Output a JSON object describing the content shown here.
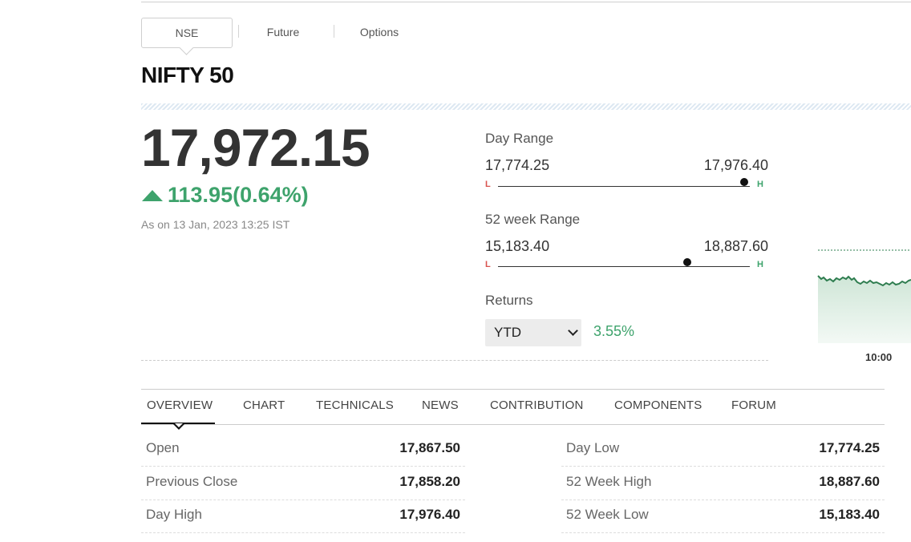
{
  "exchange_tabs": [
    "NSE",
    "Future",
    "Options"
  ],
  "index_name": "NIFTY 50",
  "price": "17,972.15",
  "change": "113.95(0.64%)",
  "as_on": "As on 13 Jan, 2023 13:25 IST",
  "day_range": {
    "label": "Day Range",
    "low": "17,774.25",
    "high": "17,976.40",
    "low_marker": "L",
    "high_marker": "H",
    "current": 17972.15
  },
  "week52_range": {
    "label": "52 week Range",
    "low": "15,183.40",
    "high": "18,887.60",
    "low_marker": "L",
    "high_marker": "H",
    "current": 17972.15
  },
  "returns": {
    "label": "Returns",
    "period": "YTD",
    "value": "3.55%"
  },
  "mini_chart": {
    "time_label": "10:00",
    "line_color": "#2e7d4f",
    "fill_color": "#e3f1e8"
  },
  "section_tabs": [
    "OVERVIEW",
    "CHART",
    "TECHNICALS",
    "NEWS",
    "CONTRIBUTION",
    "COMPONENTS",
    "FORUM"
  ],
  "stats_left": [
    {
      "label": "Open",
      "value": "17,867.50"
    },
    {
      "label": "Previous Close",
      "value": "17,858.20"
    },
    {
      "label": "Day High",
      "value": "17,976.40"
    }
  ],
  "stats_right": [
    {
      "label": "Day Low",
      "value": "17,774.25"
    },
    {
      "label": "52 Week High",
      "value": "18,887.60"
    },
    {
      "label": "52 Week Low",
      "value": "15,183.40"
    }
  ],
  "colors": {
    "up": "#3ea36c",
    "low_marker": "#d9534f"
  }
}
